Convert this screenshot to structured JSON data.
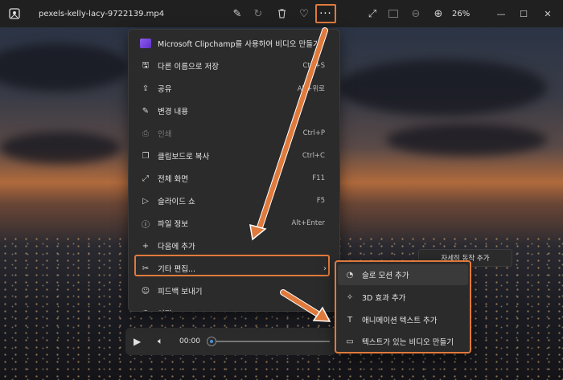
{
  "titlebar": {
    "file_name": "pexels-kelly-lacy-9722139.mp4",
    "zoom": "26%",
    "more_label": "···",
    "min": "—",
    "max": "☐",
    "close": "✕"
  },
  "menu": {
    "items": [
      {
        "label": "Microsoft Clipchamp를 사용하여 비디오 만들기",
        "shortcut": "",
        "icon": "clipchamp-icon"
      },
      {
        "label": "다른 이름으로 저장",
        "shortcut": "Ctrl+S",
        "icon": "save-icon"
      },
      {
        "label": "공유",
        "shortcut": "Alt+위로",
        "icon": "share-icon"
      },
      {
        "label": "변경 내용",
        "shortcut": "",
        "icon": "edit-icon"
      },
      {
        "label": "인쇄",
        "shortcut": "Ctrl+P",
        "icon": "print-icon",
        "disabled": true
      },
      {
        "label": "클립보드로 복사",
        "shortcut": "Ctrl+C",
        "icon": "copy-icon"
      },
      {
        "label": "전체 화면",
        "shortcut": "F11",
        "icon": "fullscreen-icon"
      },
      {
        "label": "슬라이드 쇼",
        "shortcut": "F5",
        "icon": "slideshow-icon"
      },
      {
        "label": "파일 정보",
        "shortcut": "Alt+Enter",
        "icon": "info-icon"
      },
      {
        "label": "다음에 추가",
        "shortcut": "",
        "icon": "plus-icon"
      },
      {
        "label": "기타 편집...",
        "shortcut": "",
        "icon": "more-edits-icon"
      },
      {
        "label": "피드백 보내기",
        "shortcut": "",
        "icon": "feedback-icon"
      },
      {
        "label": "설정",
        "shortcut": "",
        "icon": "settings-icon"
      }
    ]
  },
  "submenu": {
    "items": [
      {
        "label": "슬로 모션 추가",
        "icon": "slow-motion-icon"
      },
      {
        "label": "3D 효과 추가",
        "icon": "3d-effects-icon"
      },
      {
        "label": "애니메이션 텍스트 추가",
        "icon": "animated-text-icon"
      },
      {
        "label": "텍스트가 있는 비디오 만들기",
        "icon": "video-text-icon"
      }
    ]
  },
  "tooltip": "자세히 동작 추가",
  "player": {
    "time": "00:00",
    "progress": 0
  },
  "colors": {
    "highlight": "#e07a3c",
    "menu_bg": "#2b2b2b",
    "accent": "#4a8fd8"
  }
}
